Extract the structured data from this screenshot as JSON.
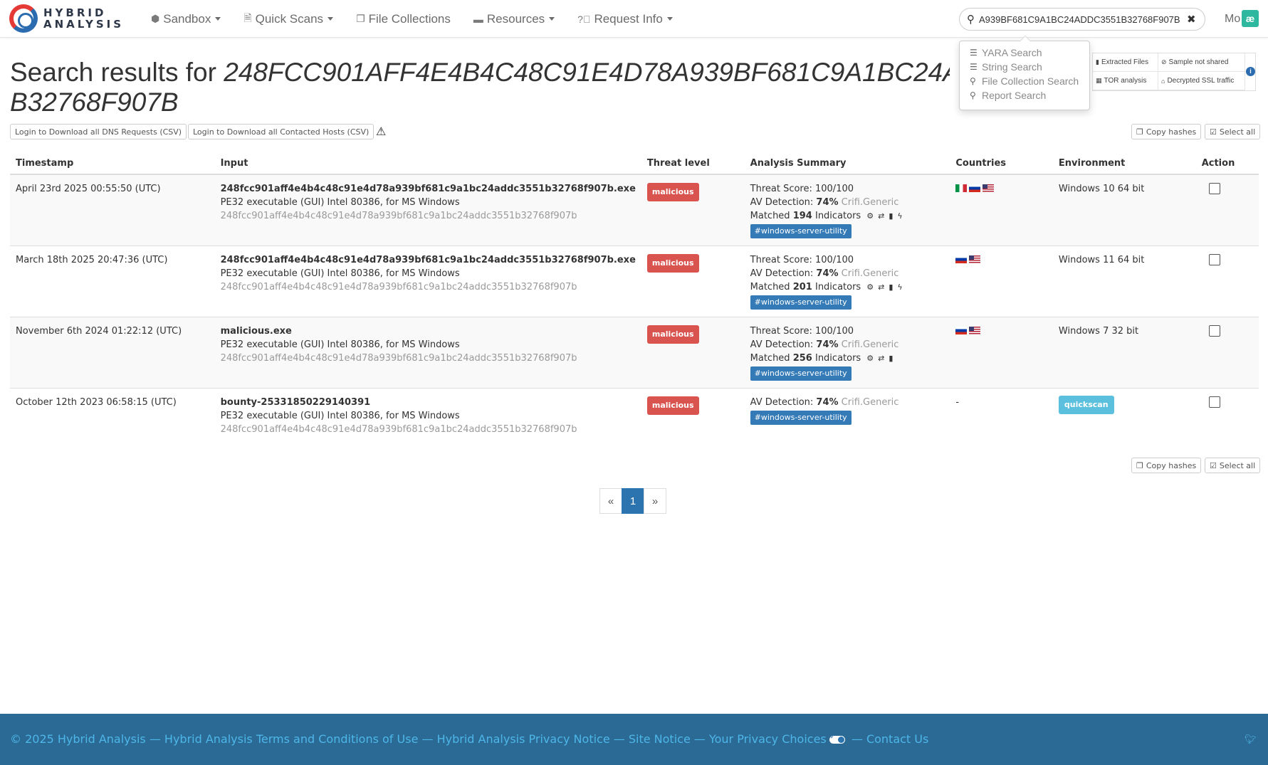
{
  "brand": {
    "line1": "HYBRID",
    "line2": "ANALYSIS"
  },
  "nav": {
    "items": [
      {
        "label": "Sandbox",
        "icon": "cube-icon",
        "dropdown": true
      },
      {
        "label": "Quick Scans",
        "icon": "file-scan-icon",
        "dropdown": true
      },
      {
        "label": "File Collections",
        "icon": "files-icon",
        "dropdown": false
      },
      {
        "label": "Resources",
        "icon": "folder-icon",
        "dropdown": true
      },
      {
        "label": "Request Info",
        "icon": "question-icon",
        "dropdown": true
      }
    ],
    "more_label": "Mo",
    "badge": "æ"
  },
  "search": {
    "value": "A939BF681C9A1BC24ADDC3551B32768F907B",
    "dropdown": [
      {
        "label": "YARA Search",
        "icon": "database-icon"
      },
      {
        "label": "String Search",
        "icon": "database-icon"
      },
      {
        "label": "File Collection Search",
        "icon": "search-icon"
      },
      {
        "label": "Report Search",
        "icon": "search-icon"
      }
    ]
  },
  "features": {
    "extracted_files": "Extracted Files",
    "sample_not_shared": "Sample not shared",
    "tor_analysis": "TOR analysis",
    "decrypted_ssl": "Decrypted SSL traffic",
    "info": "i"
  },
  "title": {
    "prefix": "Search results for",
    "hash_line1": "248FCC901AFF4E4B4C48C91E4D78A939BF681C9A1BC24ADDC3551",
    "hash_line2": "B32768F907B"
  },
  "actions": {
    "dns_csv": "Login to Download all DNS Requests (CSV)",
    "hosts_csv": "Login to Download all Contacted Hosts (CSV)",
    "copy_hashes": "Copy hashes",
    "select_all": "Select all"
  },
  "table": {
    "headers": {
      "timestamp": "Timestamp",
      "input": "Input",
      "threat": "Threat level",
      "summary": "Analysis Summary",
      "countries": "Countries",
      "environment": "Environment",
      "action": "Action"
    },
    "rows": [
      {
        "timestamp": "April 23rd 2025 00:55:50 (UTC)",
        "filename": "248fcc901aff4e4b4c48c91e4d78a939bf681c9a1bc24addc3551b32768f907b.exe",
        "filetype": "PE32 executable (GUI) Intel 80386, for MS Windows",
        "hash": "248fcc901aff4e4b4c48c91e4d78a939bf681c9a1bc24addc3551b32768f907b",
        "threat": "malicious",
        "threat_score_label": "Threat Score: 100/100",
        "av_label": "AV Detection:",
        "av_value": "74%",
        "av_name": "Crifi.Generic",
        "matched_prefix": "Matched",
        "matched_count": "194",
        "matched_suffix": "Indicators",
        "tag": "#windows-server-utility",
        "countries": [
          "it",
          "ru",
          "us"
        ],
        "environment": "Windows 10 64 bit"
      },
      {
        "timestamp": "March 18th 2025 20:47:36 (UTC)",
        "filename": "248fcc901aff4e4b4c48c91e4d78a939bf681c9a1bc24addc3551b32768f907b.exe",
        "filetype": "PE32 executable (GUI) Intel 80386, for MS Windows",
        "hash": "248fcc901aff4e4b4c48c91e4d78a939bf681c9a1bc24addc3551b32768f907b",
        "threat": "malicious",
        "threat_score_label": "Threat Score: 100/100",
        "av_label": "AV Detection:",
        "av_value": "74%",
        "av_name": "Crifi.Generic",
        "matched_prefix": "Matched",
        "matched_count": "201",
        "matched_suffix": "Indicators",
        "tag": "#windows-server-utility",
        "countries": [
          "ru",
          "us"
        ],
        "environment": "Windows 11 64 bit"
      },
      {
        "timestamp": "November 6th 2024 01:22:12 (UTC)",
        "filename": "malicious.exe",
        "filetype": "PE32 executable (GUI) Intel 80386, for MS Windows",
        "hash": "248fcc901aff4e4b4c48c91e4d78a939bf681c9a1bc24addc3551b32768f907b",
        "threat": "malicious",
        "threat_score_label": "Threat Score: 100/100",
        "av_label": "AV Detection:",
        "av_value": "74%",
        "av_name": "Crifi.Generic",
        "matched_prefix": "Matched",
        "matched_count": "256",
        "matched_suffix": "Indicators",
        "tag": "#windows-server-utility",
        "countries": [
          "ru",
          "us"
        ],
        "environment": "Windows 7 32 bit"
      },
      {
        "timestamp": "October 12th 2023 06:58:15 (UTC)",
        "filename": "bounty-25331850229140391",
        "filetype": "PE32 executable (GUI) Intel 80386, for MS Windows",
        "hash": "248fcc901aff4e4b4c48c91e4d78a939bf681c9a1bc24addc3551b32768f907b",
        "threat": "malicious",
        "av_label": "AV Detection:",
        "av_value": "74%",
        "av_name": "Crifi.Generic",
        "tag": "#windows-server-utility",
        "countries_text": "-",
        "environment_badge": "quickscan"
      }
    ]
  },
  "pagination": {
    "prev": "«",
    "current": "1",
    "next": "»"
  },
  "footer": {
    "copyright": "© 2025 Hybrid Analysis",
    "terms": "Hybrid Analysis Terms and Conditions of Use",
    "privacy": "Hybrid Analysis Privacy Notice",
    "site_notice": "Site Notice",
    "privacy_choices": "Your Privacy Choices",
    "contact": "Contact Us",
    "separator": "—"
  },
  "colors": {
    "malicious": "#d9534f",
    "tag": "#337ab7",
    "quickscan": "#5bc0de",
    "footer_bg": "#2b6a94",
    "footer_link": "#4db6e8"
  }
}
